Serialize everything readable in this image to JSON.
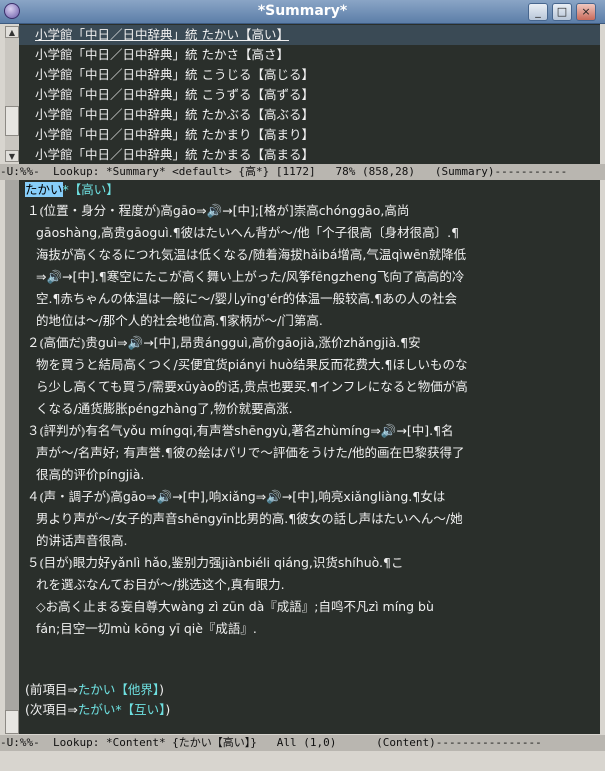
{
  "window": {
    "title": "*Summary*",
    "btn_min": "_",
    "btn_max": "□",
    "btn_close": "×"
  },
  "summary": {
    "lines": [
      "小学館「中日／日中辞典」統 たかい【高い】",
      "小学館「中日／日中辞典」統 たかさ【高さ】",
      "小学館「中日／日中辞典」統 こうじる【高じる】",
      "小学館「中日／日中辞典」統 こうずる【高ずる】",
      "小学館「中日／日中辞典」統 たかぶる【高ぶる】",
      "小学館「中日／日中辞典」統 たかまり【高まり】",
      "小学館「中日／日中辞典」統 たかまる【高まる】"
    ],
    "modeline": "-U:%%-  Lookup: *Summary* <default> {高*} [1172]   78% (858,28)   (Summary)-----------"
  },
  "content": {
    "head_word": "たかい",
    "head_star": "*",
    "head_kanji": "【高い】",
    "body_lines": [
      "１⦅位置・身分・程度が⦆高gāo⇒🔊→[中];[格が]崇高chónggāo,高尚",
      "gāoshàng,高贵gāoguì.¶彼はたいへん背が～/他「个子很高〔身材很高〕.¶",
      "海抜が高くなるにつれ気温は低くなる/随着海拔hǎibá增高,气温qìwēn就降低",
      "⇒🔊→[中].¶寒空にたこが高く舞い上がった/风筝fēngzheng飞向了高高的冷",
      "空.¶赤ちゃんの体温は一般に～/婴儿yīng'ér的体温一般较高.¶あの人の社会",
      "的地位は～/那个人的社会地位高.¶家柄が～/门第高.",
      "２⦅高価だ⦆贵guì⇒🔊→[中],昂贵ángguì,高价gāojià,涨价zhǎngjià.¶安",
      "物を買うと結局高くつく/买便宜货piányi huò结果反而花费大.¶ほしいものな",
      "ら少し高くても買う/需要xūyào的话,贵点也要买.¶インフレになると物価が高",
      "くなる/通货膨胀péngzhàng了,物价就要高涨.",
      "３⦅評判が⦆有名气yǒu míngqi,有声誉shēngyù,著名zhùmíng⇒🔊→[中].¶名",
      "声が～/名声好; 有声誉.¶彼の絵はパリで～評価をうけた/他的画在巴黎获得了",
      "很高的评价píngjià.",
      "４⦅声・調子が⦆高gāo⇒🔊→[中],响xiǎng⇒🔊→[中],响亮xiǎngliàng.¶女は",
      "男より声が～/女子的声音shēngyīn比男的高.¶彼女の話し声はたいへん～/她",
      "的讲话声音很高.",
      "５⦅目が⦆眼力好yǎnlì hǎo,鉴别力强jiànbiéli qiáng,识货shíhuò.¶こ",
      "れを選ぶなんてお目が～/挑选这个,真有眼力.",
      "◇お高く止まる妄自尊大wàng zì zūn dà『成語』;自鸣不凡zì míng bù",
      "fán;目空一切mù kōng yī qiè『成語』."
    ],
    "prev_label": "(前項目⇒",
    "prev_word": "たかい【他界】",
    "next_label": "(次項目⇒",
    "next_word": "たがい*【互い】",
    "close_paren": ")",
    "modeline": "-U:%%-  Lookup: *Content* {たかい【高い】}   All (1,0)      (Content)----------------"
  }
}
